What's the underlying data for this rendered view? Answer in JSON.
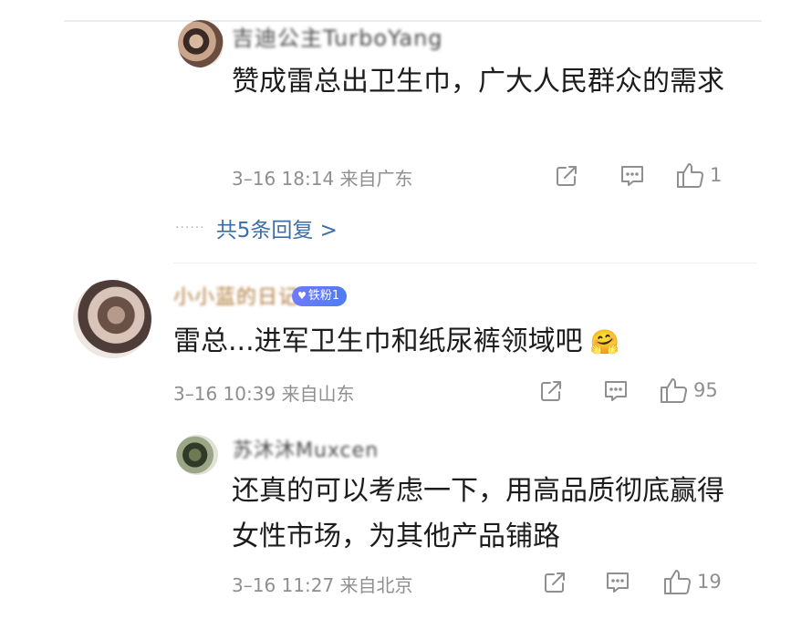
{
  "comments": [
    {
      "username": "吉迪公主TurboYang",
      "text": "赞成雷总出卫生巾，广大人民群众的需求",
      "meta": "3–16 18:14  来自广东",
      "likes": "1",
      "replies_label": "共5条回复 >"
    },
    {
      "username": "小小蓝的日记",
      "badge": "铁粉1",
      "text": "雷总...进军卫生巾和纸尿裤领域吧",
      "emoji": "🤗",
      "meta": "3–16 10:39  来自山东",
      "likes": "95"
    },
    {
      "username": "苏沐沐Muxcen",
      "text": "还真的可以考虑一下，用高品质彻底赢得女性市场，为其他产品铺路",
      "meta": "3–16 11:27  来自北京",
      "likes": "19"
    }
  ],
  "icons": [
    "share-icon",
    "comment-icon",
    "like-icon",
    "more-dots-icon"
  ],
  "colors": {
    "link": "#3e6ea8",
    "meta": "#8f8f8f",
    "badge": "#5a7cf5"
  }
}
